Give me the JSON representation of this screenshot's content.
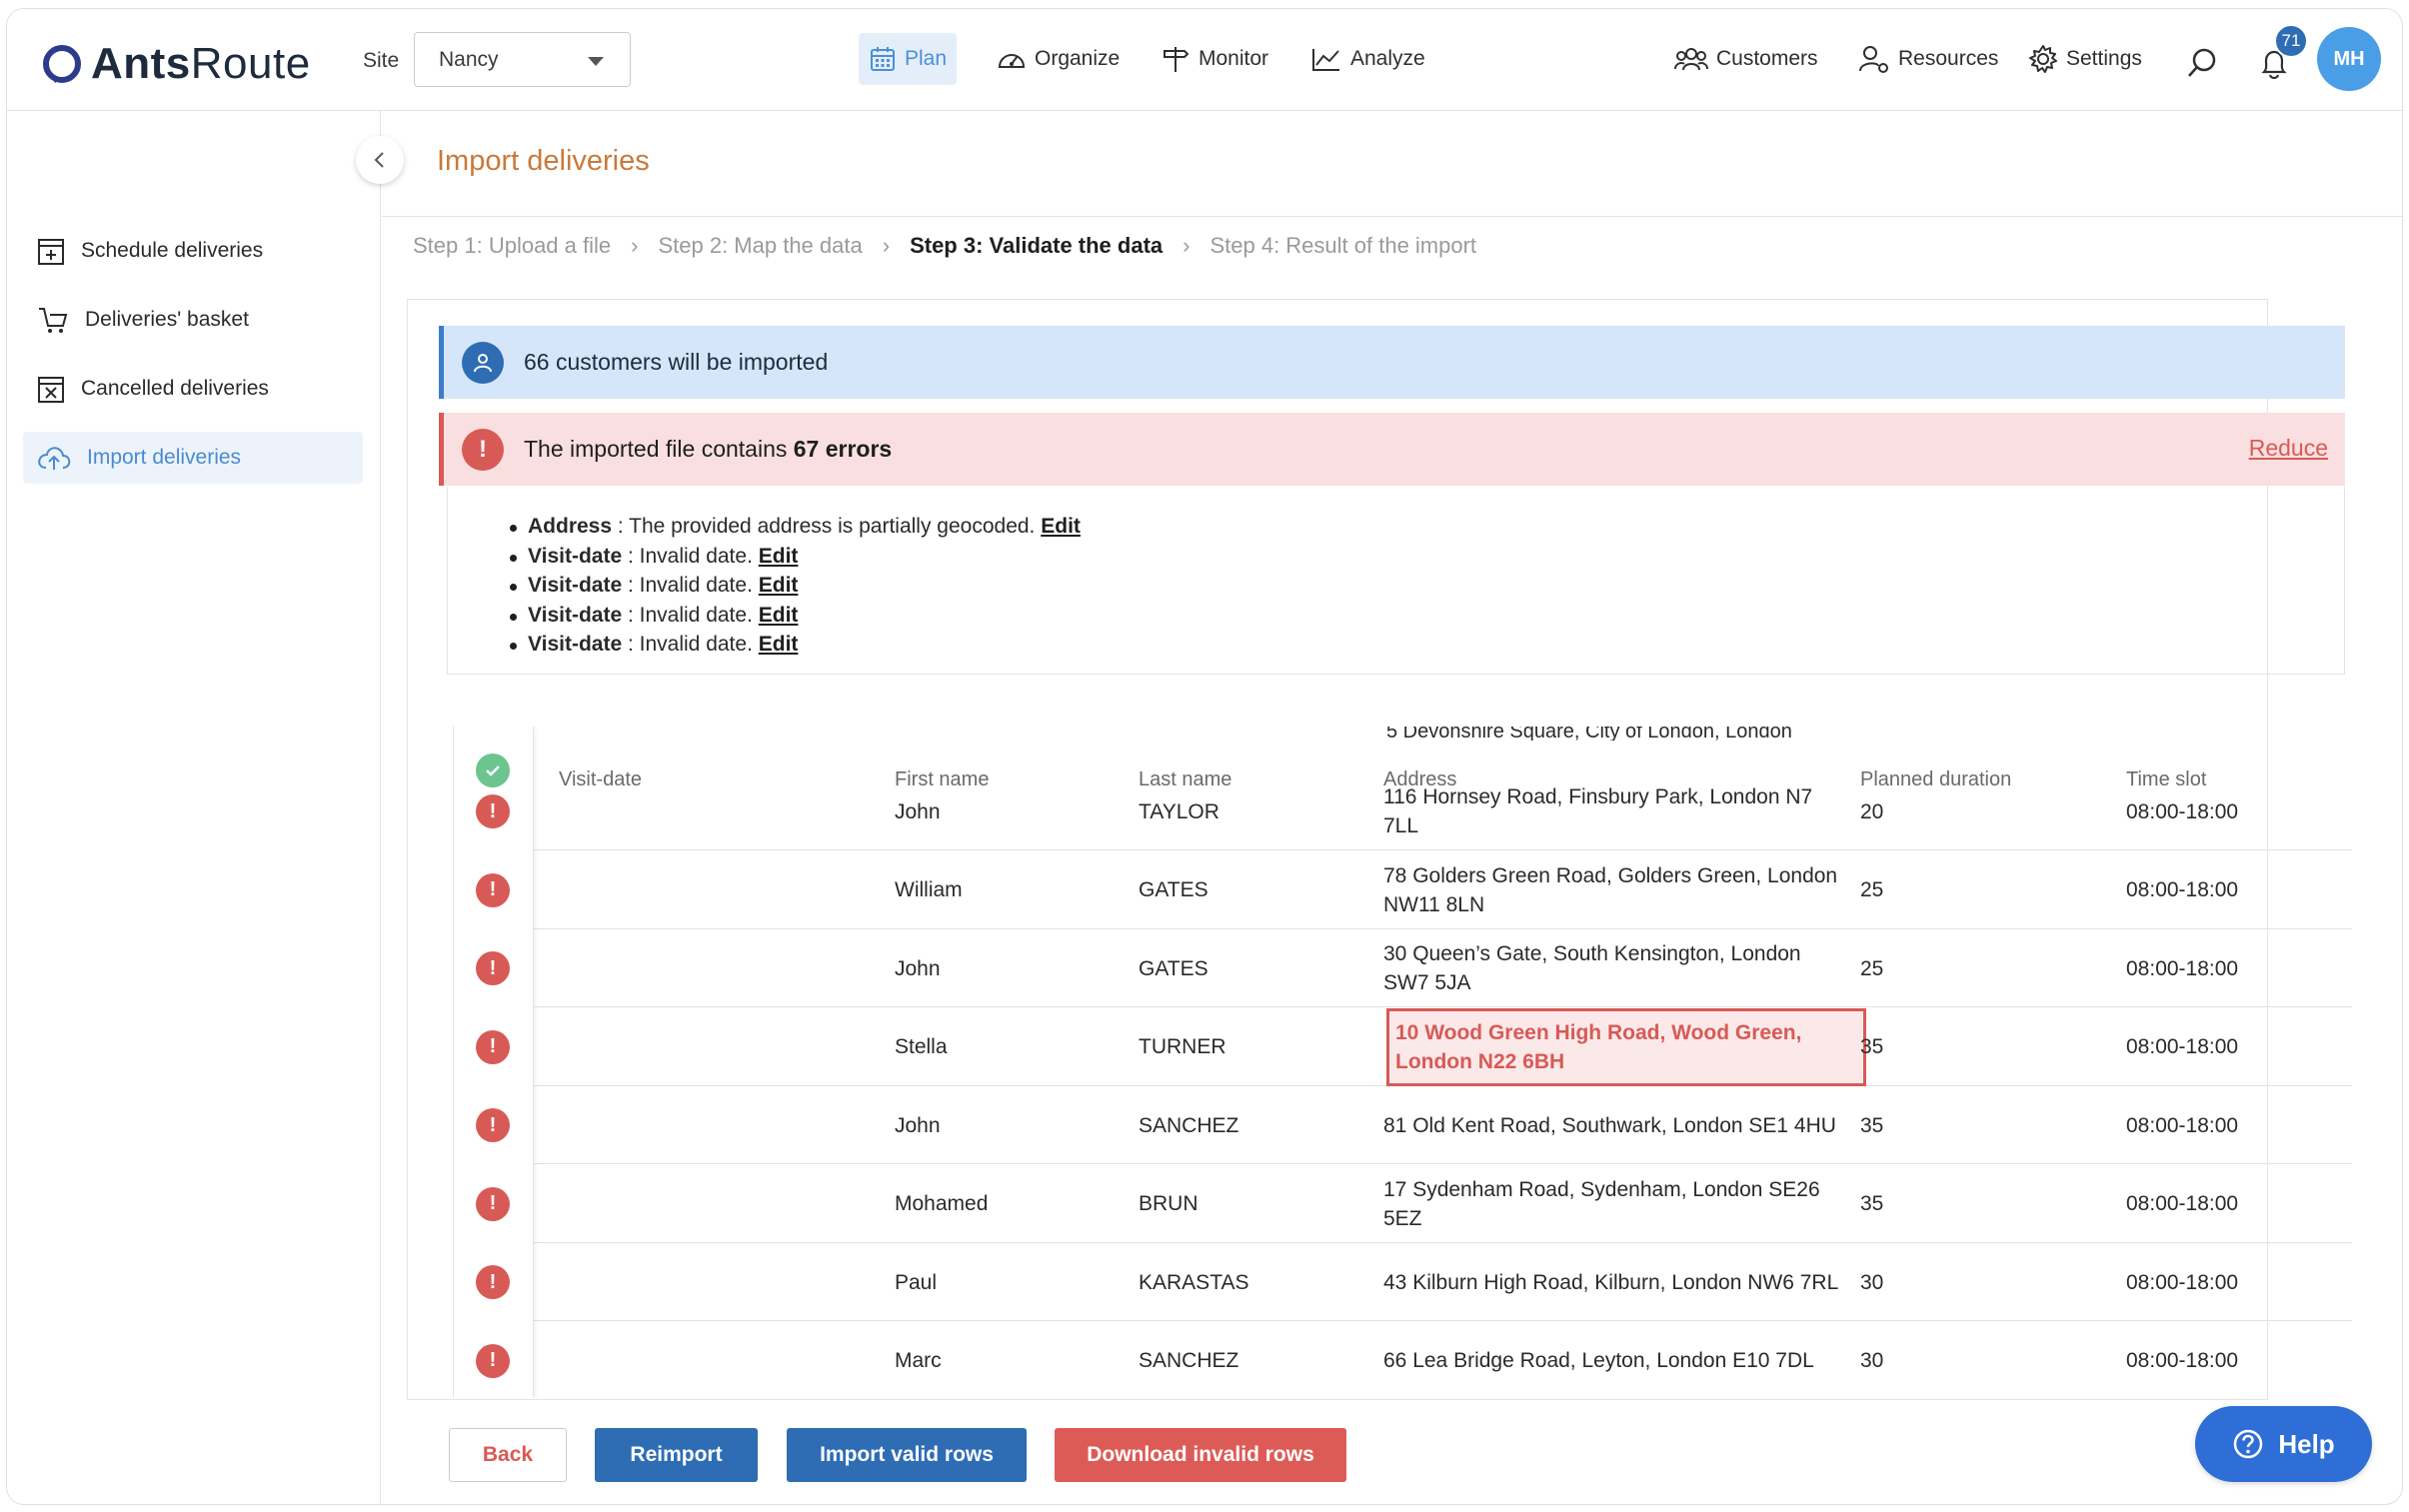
{
  "app": {
    "brand_prefix": "Ants",
    "brand_suffix": "Route"
  },
  "topbar": {
    "site_label": "Site",
    "site_value": "Nancy",
    "nav": [
      "Plan",
      "Organize",
      "Monitor",
      "Analyze"
    ],
    "right_nav": [
      "Customers",
      "Resources",
      "Settings"
    ],
    "notification_count": "71",
    "avatar_initials": "MH"
  },
  "sidebar": {
    "items": [
      {
        "label": "Schedule deliveries",
        "icon": "calendar-plus-icon"
      },
      {
        "label": "Deliveries' basket",
        "icon": "basket-icon"
      },
      {
        "label": "Cancelled deliveries",
        "icon": "calendar-x-icon"
      },
      {
        "label": "Import deliveries",
        "icon": "cloud-upload-icon",
        "active": true
      }
    ]
  },
  "page": {
    "title": "Import deliveries",
    "steps": [
      "Step 1: Upload a file",
      "Step 2: Map the data",
      "Step 3: Validate the data",
      "Step 4: Result of the import"
    ],
    "current_step": 2
  },
  "info_banner": {
    "text": "66 customers will be imported"
  },
  "error_banner": {
    "prefix": "The imported file contains",
    "count_text": "67 errors",
    "reduce_label": "Reduce",
    "errors": [
      {
        "field": "Address",
        "message": " : The provided address is partially geocoded. ",
        "edit": "Edit"
      },
      {
        "field": "Visit-date",
        "message": " : Invalid date. ",
        "edit": "Edit"
      },
      {
        "field": "Visit-date",
        "message": " : Invalid date. ",
        "edit": "Edit"
      },
      {
        "field": "Visit-date",
        "message": " : Invalid date. ",
        "edit": "Edit"
      },
      {
        "field": "Visit-date",
        "message": " : Invalid date. ",
        "edit": "Edit"
      }
    ]
  },
  "table": {
    "peek_text": "5 Devonshire Square, City of London, London",
    "headers": [
      "Visit-date",
      "First name",
      "Last name",
      "Address",
      "Planned duration",
      "Time slot"
    ],
    "rows": [
      {
        "first": "John",
        "last": "TAYLOR",
        "address": "116 Hornsey Road, Finsbury Park, London N7 7LL",
        "duration": "20",
        "slot": "08:00-18:00"
      },
      {
        "first": "William",
        "last": "GATES",
        "address": "78 Golders Green Road, Golders Green, London NW11 8LN",
        "duration": "25",
        "slot": "08:00-18:00"
      },
      {
        "first": "John",
        "last": "GATES",
        "address": "30 Queen’s Gate, South Kensington, London SW7 5JA",
        "duration": "25",
        "slot": "08:00-18:00"
      },
      {
        "first": "Stella",
        "last": "TURNER",
        "address": "10 Wood Green High Road, Wood Green, London N22 6BH",
        "duration": "35",
        "slot": "08:00-18:00",
        "address_error": true
      },
      {
        "first": "John",
        "last": "SANCHEZ",
        "address": "81 Old Kent Road, Southwark, London SE1 4HU",
        "duration": "35",
        "slot": "08:00-18:00"
      },
      {
        "first": "Mohamed",
        "last": "BRUN",
        "address": "17 Sydenham Road, Sydenham, London SE26 5EZ",
        "duration": "35",
        "slot": "08:00-18:00"
      },
      {
        "first": "Paul",
        "last": "KARASTAS",
        "address": "43 Kilburn High Road, Kilburn, London NW6 7RL",
        "duration": "30",
        "slot": "08:00-18:00"
      },
      {
        "first": "Marc",
        "last": "SANCHEZ",
        "address": "66 Lea Bridge Road, Leyton, London E10 7DL",
        "duration": "30",
        "slot": "08:00-18:00"
      }
    ]
  },
  "footer": {
    "back": "Back",
    "reimport": "Reimport",
    "import_valid": "Import valid rows",
    "download_invalid": "Download invalid rows"
  },
  "help": {
    "label": "Help"
  },
  "colors": {
    "accent": "#2e6db4",
    "error": "#d85a56",
    "title": "#c97a3a",
    "info_bg": "#d6e6fa",
    "error_bg": "#f9dfdf"
  }
}
